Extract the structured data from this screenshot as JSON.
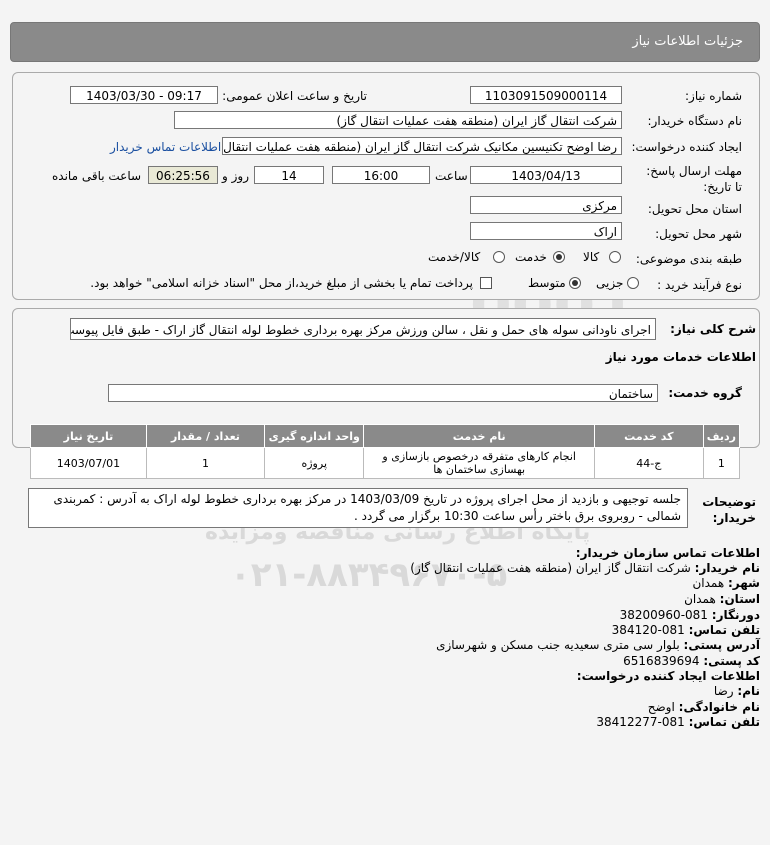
{
  "header": {
    "title": "جزئیات اطلاعات نیاز"
  },
  "form": {
    "need_number_label": "شماره نیاز:",
    "need_number": "1103091509000114",
    "announce_label": "تاریخ و ساعت اعلان عمومی:",
    "announce_value": "1403/03/30 - 09:17",
    "buyer_org_label": "نام دستگاه خریدار:",
    "buyer_org": "شرکت انتقال گاز ایران (منطقه هفت عملیات انتقال گاز)",
    "requester_label": "ایجاد کننده درخواست:",
    "requester": "رضا اوضح تکنیسین مکانیک شرکت انتقال گاز ایران (منطقه هفت عملیات انتقال گ",
    "contact_link": "اطلاعات تماس خریدار",
    "deadline_label": "مهلت ارسال پاسخ: تا تاریخ:",
    "deadline_date": "1403/04/13",
    "time_label": "ساعت",
    "deadline_time": "16:00",
    "days": "14",
    "days_label": "روز و",
    "remaining_time": "06:25:56",
    "remaining_label": "ساعت باقی مانده",
    "province_label": "استان محل تحویل:",
    "province": "مرکزی",
    "city_label": "شهر محل تحویل:",
    "city": "اراک",
    "category_label": "طبقه بندی موضوعی:",
    "category_options": [
      "کالا",
      "خدمت",
      "کالا/خدمت"
    ],
    "category_selected": "خدمت",
    "process_label": "نوع فرآیند خرید :",
    "process_options": [
      "جزیی",
      "متوسط"
    ],
    "process_selected": "متوسط",
    "payment_note": "پرداخت تمام یا بخشی از مبلغ خرید،از محل \"اسناد خزانه اسلامی\" خواهد بود."
  },
  "description": {
    "label": "شرح کلی نیاز:",
    "text": "اجرای ناودانی سوله های حمل و نقل ، سالن ورزش مرکز بهره برداری خطوط لوله انتقال گاز اراک - طبق فایل پیوست"
  },
  "services": {
    "section_title": "اطلاعات خدمات مورد نیاز",
    "group_label": "گروه خدمت:",
    "group_value": "ساختمان",
    "columns": [
      "ردیف",
      "کد خدمت",
      "نام خدمت",
      "واحد اندازه گیری",
      "تعداد / مقدار",
      "تاریخ نیاز"
    ],
    "rows": [
      {
        "index": "1",
        "code": "ج-44",
        "name": "انجام کارهای متفرقه درخصوص بازسازی و بهسازی ساختمان ها",
        "unit": "پروژه",
        "qty": "1",
        "date": "1403/07/01"
      }
    ]
  },
  "buyer_notes": {
    "label": "توضیحات خریدار:",
    "line1": "جلسه توجیهی و بازدید از محل اجرای پروژه در تاریخ 1403/03/09 در مرکز بهره برداری خطوط لوله اراک به آدرس : کمربندی",
    "line2": "شمالی - روبروی برق باختر رأس ساعت 10:30 برگزار می گردد ."
  },
  "contact": {
    "org_title": "اطلاعات تماس سازمان خریدار:",
    "buyer_name_label": "نام خریدار:",
    "buyer_name": "شرکت انتقال گاز ایران (منطقه هفت عملیات انتقال گاز)",
    "city_label": "شهر:",
    "city": "همدان",
    "province_label": "استان:",
    "province": "همدان",
    "fax_label": "دورنگار:",
    "fax": "081-38200960",
    "phone_label": "تلفن تماس:",
    "phone": "081-384120",
    "address_label": "آدرس پستی:",
    "address": "بلوار سی متری سعیدیه جنب مسکن و شهرسازی",
    "postal_label": "کد پستی:",
    "postal": "6516839694",
    "creator_title": "اطلاعات ایجاد کننده درخواست:",
    "first_name_label": "نام:",
    "first_name": "رضا",
    "last_name_label": "نام خانوادگی:",
    "last_name": "اوضح",
    "creator_phone_label": "تلفن تماس:",
    "creator_phone": "081-38412277"
  },
  "watermark": {
    "line1": "پایگاه اطلاع رسانی مناقصه ومزایده",
    "line2": "۰۲۱-۸۸۳۴۹۶۷۰-۵"
  }
}
